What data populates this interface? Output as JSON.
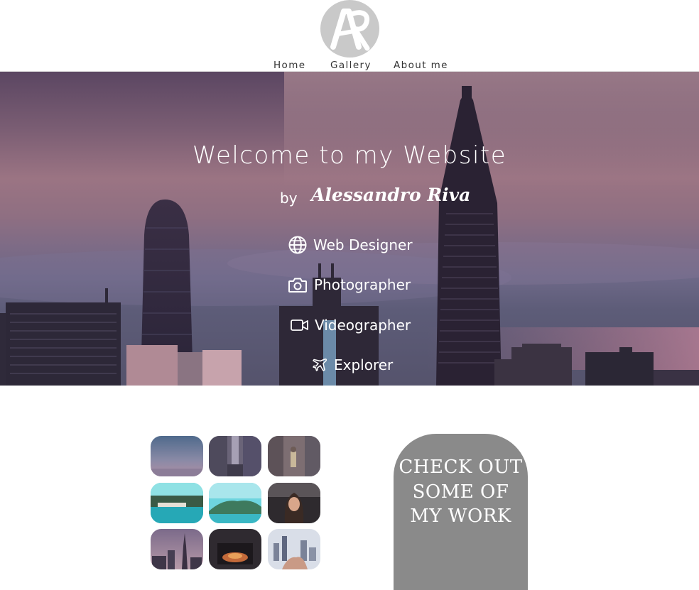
{
  "header": {
    "logo_text": "AR",
    "nav": {
      "home": "Home",
      "gallery": "Gallery",
      "about": "About me"
    }
  },
  "hero": {
    "title": "Welcome to my Website",
    "by": "by",
    "author": "Alessandro Riva",
    "roles": [
      {
        "label": "Web Designer",
        "icon": "globe-icon"
      },
      {
        "label": "Photographer",
        "icon": "camera-icon"
      },
      {
        "label": "Videographer",
        "icon": "video-camera-icon"
      },
      {
        "label": "Explorer",
        "icon": "plane-icon"
      }
    ]
  },
  "gallery": {
    "thumbnails": [
      {
        "subject": "misty-horizon"
      },
      {
        "subject": "city-street"
      },
      {
        "subject": "person-in-canyon"
      },
      {
        "subject": "tropical-beach"
      },
      {
        "subject": "turquoise-bay"
      },
      {
        "subject": "smiling-woman"
      },
      {
        "subject": "city-skyline-dusk"
      },
      {
        "subject": "fireplace"
      },
      {
        "subject": "skyline-hands"
      }
    ],
    "cta_label": "CHECK OUT SOME OF MY WORK"
  },
  "colors": {
    "cta_background": "#8a8a8a",
    "logo_background": "#c9c9c9",
    "nav_text": "#333333",
    "hero_text": "#ffffff"
  }
}
